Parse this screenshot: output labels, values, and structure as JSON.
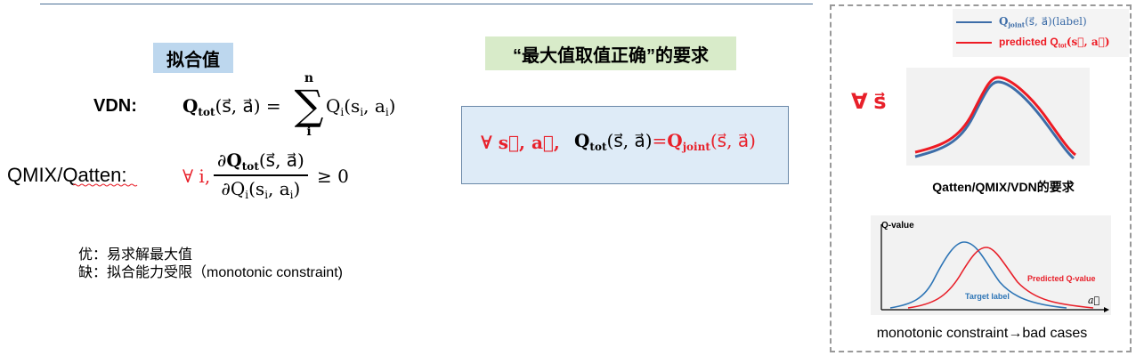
{
  "left": {
    "fit_value_label": "拟合值",
    "vdn": {
      "label": "VDN:",
      "lhs_q": "Q",
      "lhs_sub": "tot",
      "lhs_args": "(s⃗, a⃗) =",
      "sum_top": "n",
      "sum_symbol": "∑",
      "sum_bottom": "i",
      "rhs_q": "Q",
      "rhs_sub": "i",
      "rhs_args_open": "(s",
      "rhs_s_sub": "i",
      "rhs_args_mid": ", a",
      "rhs_a_sub": "i",
      "rhs_args_close": ")"
    },
    "qmix": {
      "label": "QMIX/Qatten:",
      "forall": "∀ i,",
      "num_prefix": "∂",
      "num_q": "Q",
      "num_sub": "tot",
      "num_args": "(s⃗, a⃗)",
      "den_prefix": "∂Q",
      "den_sub": "i",
      "den_args_open": "(s",
      "den_s_sub": "i",
      "den_args_mid": ", a",
      "den_a_sub": "i",
      "den_args_close": ")",
      "geq": "≥ 0"
    },
    "pros": "优：易求解最大值",
    "cons": "缺：拟合能力受限（monotonic constraint)"
  },
  "middle": {
    "requirement_label": "“最大值取值正确”的要求",
    "forall": "∀ s⃗, a⃗,",
    "q": "Q",
    "q_sub": "tot",
    "q_args": "(s⃗, a⃗)",
    "eq": "=",
    "qj": "Q",
    "qj_sub": "joint",
    "qj_args": "(s⃗, a⃗)"
  },
  "right": {
    "legend": {
      "label_item_q": "Q",
      "label_item_sub": "joint",
      "label_item_args": "(s⃗, a⃗)(label)",
      "pred_item_prefix": "predicted Q",
      "pred_item_sub": "tot",
      "pred_item_args": "(s⃗, a⃗)"
    },
    "forall_s": "∀ s⃗",
    "caption1": "Qatten/QMIX/VDN的要求",
    "chart2": {
      "ylabel": "Q-value",
      "xlabel": "a⃗",
      "target_label": "Target label",
      "predicted_label": "Predicted Q-value"
    },
    "caption2": "monotonic constraint→bad cases"
  },
  "colors": {
    "blue_curve": "#3d6da8",
    "red_curve": "#ee1b24",
    "target_curve": "#2e75b6",
    "predicted_curve": "#e8202a",
    "accent_red": "#e8202a"
  }
}
